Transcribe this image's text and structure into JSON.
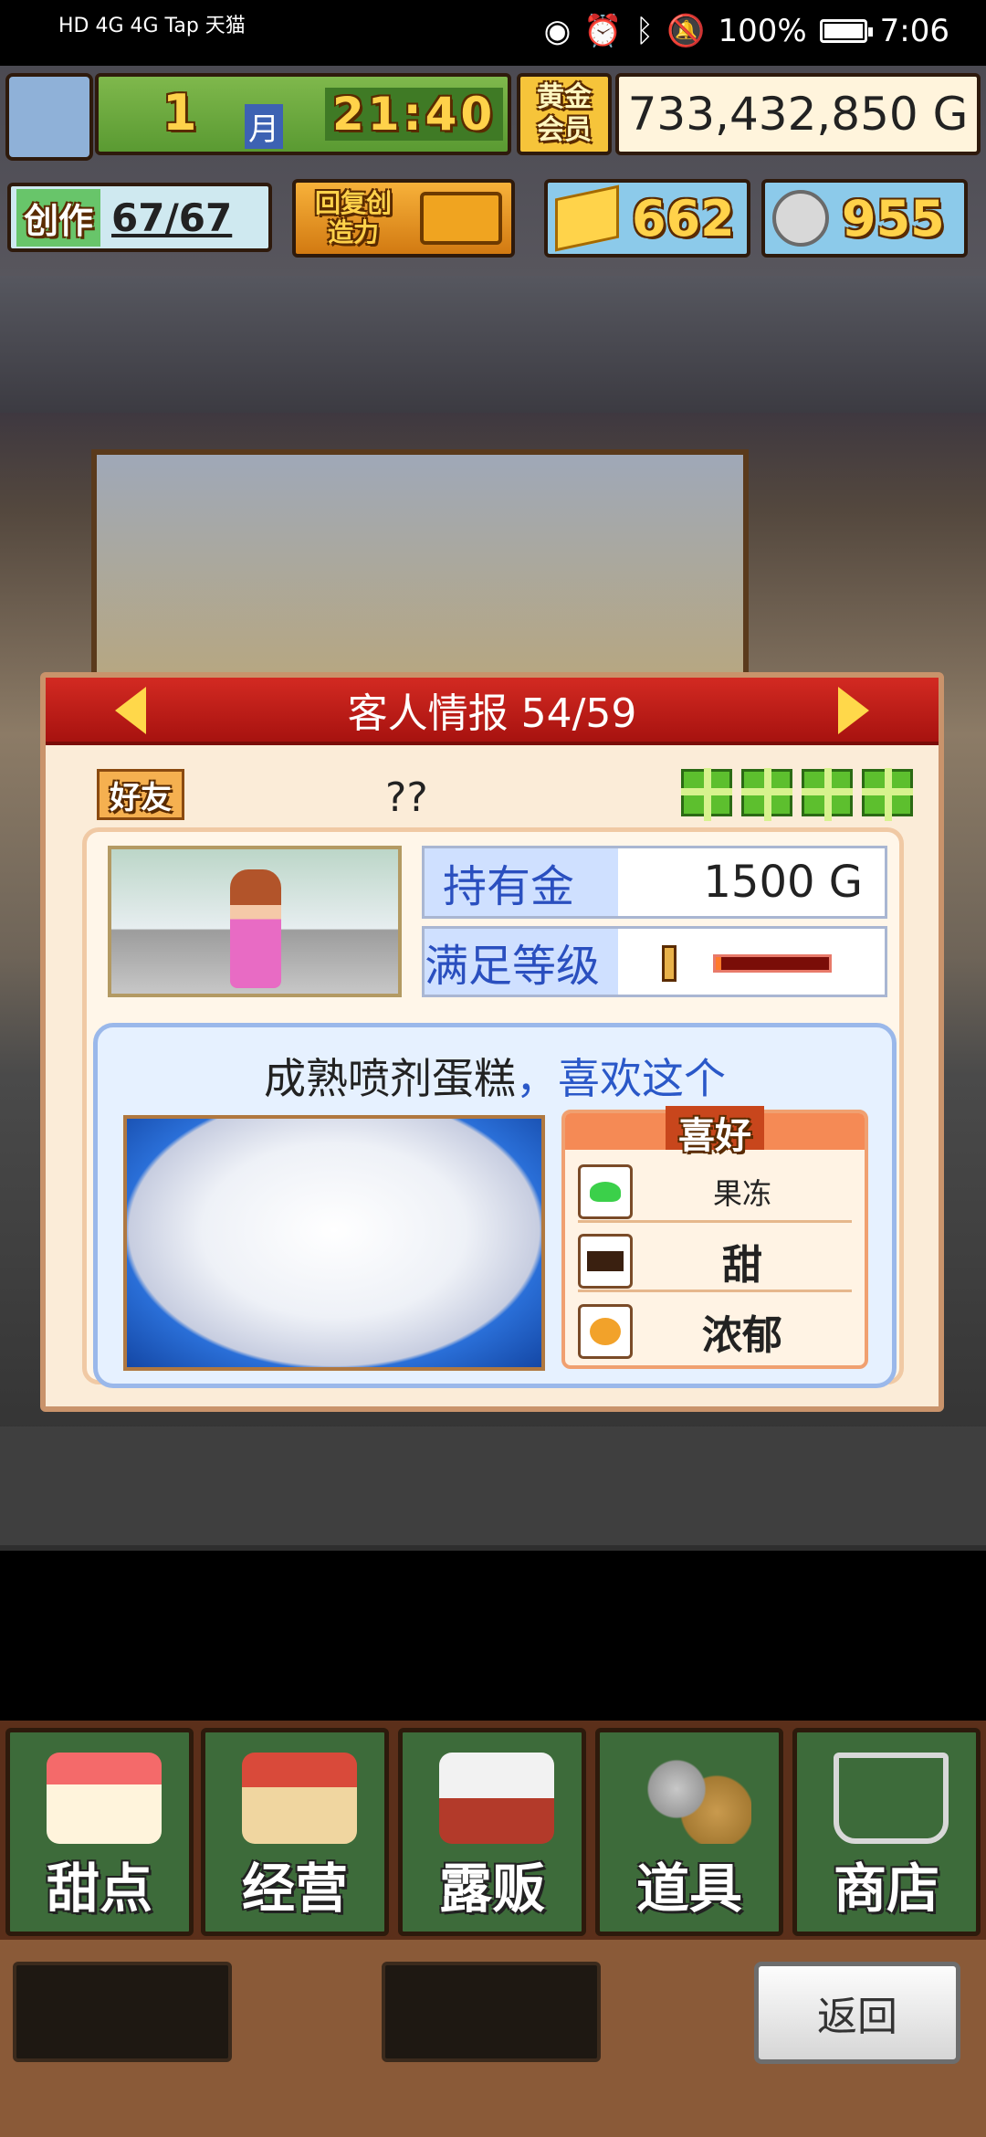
{
  "status_bar": {
    "left_text": "HD 4G 4G Tap 天猫",
    "battery": "100%",
    "time": "7:06"
  },
  "hud": {
    "month_number": "1",
    "month_unit": "月",
    "clock": "21:40",
    "membership": "黄金会员",
    "gold": "733,432,850 G",
    "create_label": "创作",
    "create_count": "67/67",
    "restore_label": "回复创造力",
    "tickets": "662",
    "coins": "955"
  },
  "panel": {
    "title": "客人情报 54/59",
    "badge": "好友",
    "customer_name": "??",
    "gift_icons": [
      "gift-icon",
      "gift-icon",
      "gift-icon",
      "gift-icon"
    ],
    "money_label": "持有金",
    "money_value": "1500 G",
    "satisfaction_label": "满足等级",
    "satisfaction_level": 0.05,
    "wish_item": "成熟喷剂蛋糕",
    "wish_suffix": "，喜欢这个",
    "prefs_title": "喜好",
    "prefs": [
      {
        "icon": "jelly-icon",
        "label": "果冻"
      },
      {
        "icon": "sweet-icon",
        "label": "甜"
      },
      {
        "icon": "rich-icon",
        "label": "浓郁"
      }
    ]
  },
  "nav": {
    "items": [
      "甜点",
      "经营",
      "露贩",
      "道具",
      "商店"
    ]
  },
  "bottom": {
    "back_label": "返回"
  },
  "colors": {
    "panel_header": "#c41d18",
    "gold_text": "#ffd24a",
    "nav_green": "#3d6b3a"
  }
}
